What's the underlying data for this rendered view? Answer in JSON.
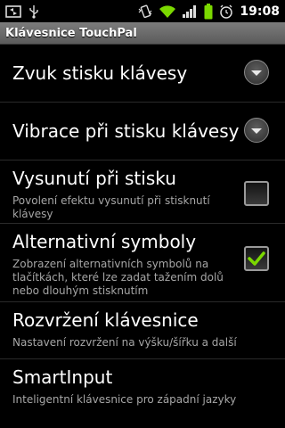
{
  "status_bar": {
    "time": "19:08",
    "icons": [
      "screen-cast-icon",
      "usb-icon",
      "vibrate-icon",
      "wifi-icon",
      "signal-icon",
      "battery-icon",
      "alarm-icon"
    ]
  },
  "title_bar": {
    "title": "Klávesnice TouchPal"
  },
  "settings": [
    {
      "title": "Zvuk stisku klávesy",
      "summary": "",
      "widget": "dropdown"
    },
    {
      "title": "Vibrace při stisku klávesy",
      "summary": "",
      "widget": "dropdown"
    },
    {
      "title": "Vysunutí při stisku",
      "summary": "Povolení efektu vysunutí při stisknutí klávesy",
      "widget": "checkbox",
      "checked": false
    },
    {
      "title": "Alternativní symboly",
      "summary": "Zobrazení alternativních symbolů na tlačítkách, které lze zadat tažením dolů nebo dlouhým stisknutím",
      "widget": "checkbox",
      "checked": true
    },
    {
      "title": "Rozvržení klávesnice",
      "summary": "Nastavení rozvržení na výšku/šířku a další",
      "widget": "none"
    },
    {
      "title": "SmartInput",
      "summary": "Inteligentní klávesnice pro západní jazyky",
      "widget": "none"
    }
  ],
  "colors": {
    "checked_mark": "#7bd800",
    "summary_text": "#a6a6a6"
  }
}
